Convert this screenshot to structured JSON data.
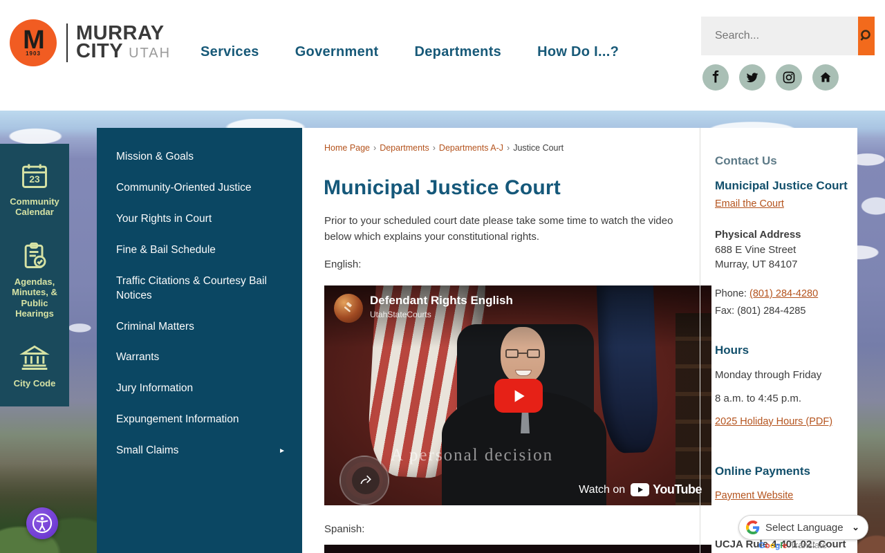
{
  "header": {
    "logo": {
      "monogram": "M",
      "year": "1903",
      "line1": "MURRAY",
      "line2": "CITY",
      "state": "UTAH"
    },
    "nav": {
      "items": [
        "Services",
        "Government",
        "Departments",
        "How Do I...?"
      ]
    },
    "search": {
      "placeholder": "Search..."
    },
    "social": {
      "icons": [
        "facebook",
        "twitter",
        "instagram",
        "nextdoor"
      ]
    }
  },
  "quick_links": {
    "items": [
      {
        "icon": "calendar",
        "label": "Community Calendar"
      },
      {
        "icon": "agenda-clipboard",
        "label": "Agendas, Minutes, & Public Hearings"
      },
      {
        "icon": "city-code-bank",
        "label": "City Code"
      }
    ]
  },
  "side_menu": {
    "items": [
      "Mission & Goals",
      "Community-Oriented Justice",
      "Your Rights in Court",
      "Fine & Bail Schedule",
      "Traffic Citations & Courtesy Bail Notices",
      "Criminal Matters",
      "Warrants",
      "Jury Information",
      "Expungement Information",
      "Small Claims"
    ],
    "submenu_arrow": "►"
  },
  "breadcrumb": {
    "separator": "›",
    "items": [
      "Home Page",
      "Departments",
      "Departments A-J",
      "Justice Court"
    ]
  },
  "page": {
    "title": "Municipal Justice Court",
    "intro": "Prior to your scheduled court date please take some time to watch the video below which explains your constitutional rights.",
    "english_label": "English:",
    "spanish_label": "Spanish:"
  },
  "video": {
    "title": "Defendant Rights English",
    "channel": "UtahStateCourts",
    "caption": "A personal decision",
    "watch_on": "Watch on",
    "brand": "YouTube"
  },
  "contact": {
    "heading": "Contact Us",
    "department": "Municipal Justice Court",
    "email_link": "Email the Court",
    "address_heading": "Physical Address",
    "address_line1": "688 E Vine Street",
    "address_line2": "Murray, UT 84107",
    "phone_label": "Phone: ",
    "phone": "(801) 284-4280",
    "fax": "Fax: (801) 284-4285",
    "hours_heading": "Hours",
    "hours_days": "Monday through Friday",
    "hours_time": "8 a.m. to 4:45 p.m.",
    "holiday_link": "2025 Holiday Hours (PDF)",
    "payments_heading": "Online Payments",
    "payment_link": "Payment Website",
    "ucja": "UCJA Rule 4-401.02: Court"
  },
  "translate": {
    "label": "Select Language",
    "brand_translate": "Translate"
  },
  "colors": {
    "accent_orange": "#f26a1c",
    "menu_teal": "#0b4763",
    "quick_teal": "#1a4a5c",
    "heading_teal": "#15587a",
    "link_orange": "#b4531d",
    "quick_text_green": "#d6e2a4"
  }
}
